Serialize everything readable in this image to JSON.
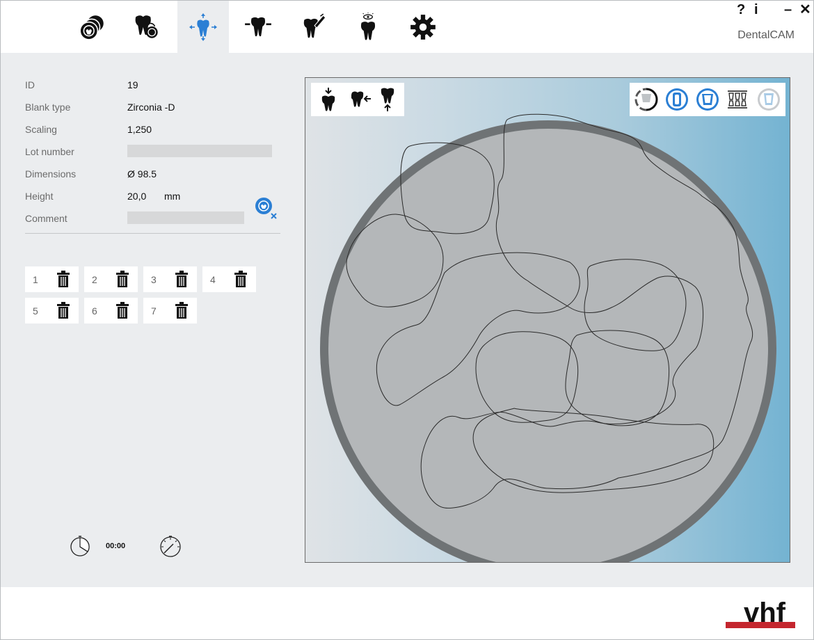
{
  "app": {
    "name": "DentalCAM"
  },
  "window_controls": {
    "help": "?",
    "info": "i",
    "minimize": "–",
    "close": "✕"
  },
  "tabs": [
    {
      "icon": "blank-discs-icon"
    },
    {
      "icon": "tooth-with-blank-icon"
    },
    {
      "icon": "tooth-positioning-icon",
      "active": true
    },
    {
      "icon": "tooth-attachment-icon"
    },
    {
      "icon": "tooth-tool-icon"
    },
    {
      "icon": "tooth-preview-icon"
    },
    {
      "icon": "gear-icon"
    }
  ],
  "blank_info": {
    "id_label": "ID",
    "id_value": "19",
    "blank_type_label": "Blank type",
    "blank_type_value": "Zirconia -D",
    "scaling_label": "Scaling",
    "scaling_value": "1,250",
    "lot_label": "Lot number",
    "lot_value": "",
    "dimensions_label": "Dimensions",
    "dimensions_value": "Ø 98.5",
    "height_label": "Height",
    "height_value": "20,0",
    "height_unit": "mm",
    "comment_label": "Comment",
    "comment_value": ""
  },
  "positions": [
    {
      "num": "1"
    },
    {
      "num": "2"
    },
    {
      "num": "3"
    },
    {
      "num": "4"
    },
    {
      "num": "5"
    },
    {
      "num": "6"
    },
    {
      "num": "7"
    }
  ],
  "timer": {
    "value": "00:00"
  },
  "colors": {
    "accent": "#2b7fd4",
    "brand_red": "#c4262e",
    "disc_fill": "#b4b7b9",
    "disc_ring": "#6f7375"
  },
  "brand": {
    "logo": "vhf"
  }
}
